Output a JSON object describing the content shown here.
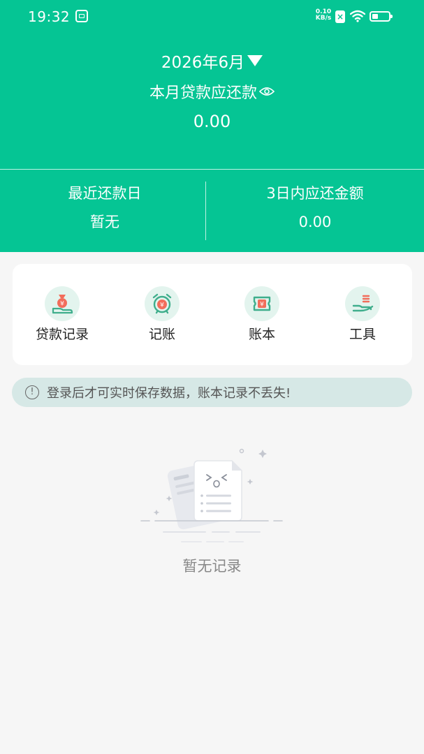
{
  "status_bar": {
    "time": "19:32",
    "net_speed_value": "0.10",
    "net_speed_unit": "KB/s",
    "icons": [
      "app-notification-icon",
      "x-app-icon",
      "wifi-icon",
      "battery-icon"
    ]
  },
  "header": {
    "month": "2026年6月",
    "due_label": "本月贷款应还款",
    "due_amount": "0.00",
    "recent_due_label": "最近还款日",
    "recent_due_value": "暂无",
    "three_day_label": "3日内应还金额",
    "three_day_value": "0.00"
  },
  "features": [
    {
      "label": "贷款记录",
      "icon": "money-bag-hand-icon"
    },
    {
      "label": "记账",
      "icon": "alarm-clock-yen-icon"
    },
    {
      "label": "账本",
      "icon": "ticket-yen-icon"
    },
    {
      "label": "工具",
      "icon": "hand-tools-icon"
    }
  ],
  "notice": {
    "text": "登录后才可实时保存数据，账本记录不丢失!"
  },
  "empty_state": {
    "text": "暂无记录"
  },
  "colors": {
    "brand_green": "#05c594",
    "background": "#f6f6f6",
    "notice_bg": "#d6e8e6",
    "icon_circle_bg": "#e3f4ee",
    "icon_accent": "#f26d5b",
    "icon_green": "#3fae8c"
  }
}
